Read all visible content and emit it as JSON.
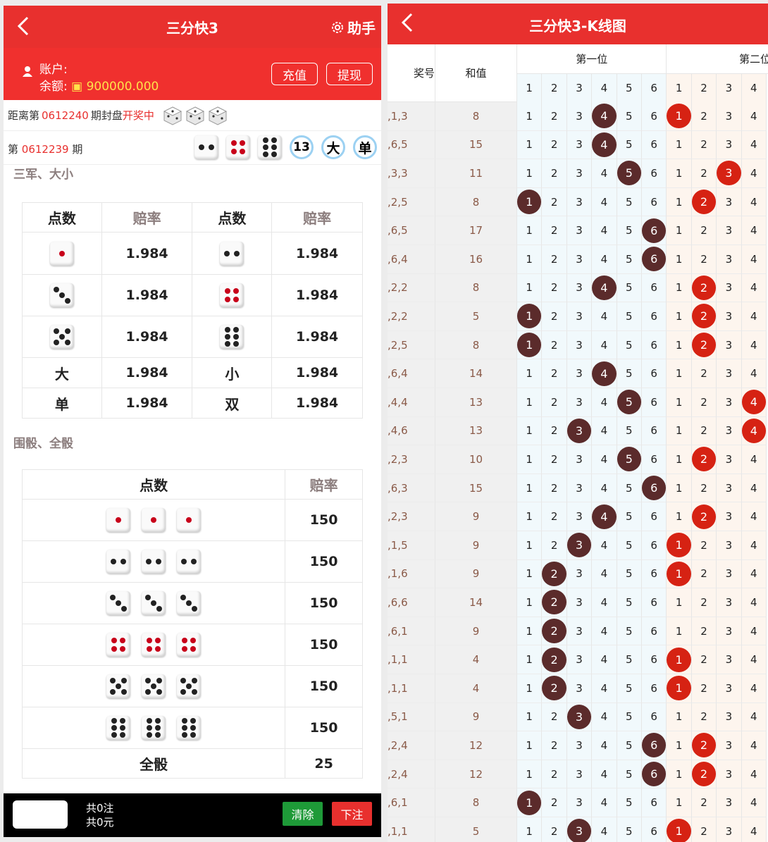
{
  "left": {
    "header": {
      "title": "三分快3",
      "helper": "助手"
    },
    "account": {
      "label_account": "账户:",
      "label_balance": "余额:",
      "balance": "900000.000",
      "recharge": "充值",
      "withdraw": "提现"
    },
    "next": {
      "prefix": "距离第",
      "issue": "0612240",
      "mid": "期封盘",
      "status": "开奖中"
    },
    "prev": {
      "prefix": "第",
      "issue": "0612239",
      "suffix": "期",
      "dice": [
        2,
        4,
        6
      ],
      "sum": "13",
      "size": "大",
      "parity": "单"
    },
    "section1": "三军、大小",
    "table1": {
      "headers": [
        "点数",
        "赔率",
        "点数",
        "赔率"
      ],
      "rows": [
        {
          "a": {
            "die": 1
          },
          "ao": "1.984",
          "b": {
            "die": 2
          },
          "bo": "1.984"
        },
        {
          "a": {
            "die": 3
          },
          "ao": "1.984",
          "b": {
            "die": 4
          },
          "bo": "1.984"
        },
        {
          "a": {
            "die": 5
          },
          "ao": "1.984",
          "b": {
            "die": 6
          },
          "bo": "1.984"
        },
        {
          "a": {
            "text": "大"
          },
          "ao": "1.984",
          "b": {
            "text": "小"
          },
          "bo": "1.984"
        },
        {
          "a": {
            "text": "单"
          },
          "ao": "1.984",
          "b": {
            "text": "双"
          },
          "bo": "1.984"
        }
      ]
    },
    "section2": "围骰、全骰",
    "table2": {
      "headers": [
        "点数",
        "赔率"
      ],
      "rows": [
        {
          "die": 1,
          "odds": "150"
        },
        {
          "die": 2,
          "odds": "150"
        },
        {
          "die": 3,
          "odds": "150"
        },
        {
          "die": 4,
          "odds": "150"
        },
        {
          "die": 5,
          "odds": "150"
        },
        {
          "die": 6,
          "odds": "150"
        },
        {
          "text": "全骰",
          "odds": "25"
        }
      ]
    },
    "bottom": {
      "count": "共0注",
      "amount": "共0元",
      "clear": "清除",
      "submit": "下注"
    },
    "colors": {
      "header": "#e8302e",
      "balance": "#ffe14a",
      "clear": "#1e9a38",
      "submit": "#e8302e"
    }
  },
  "right": {
    "header": {
      "title": "三分快3-K线图"
    },
    "columns": {
      "kj": "奖号",
      "hz": "和值",
      "pos1": "第一位",
      "pos2": "第二位",
      "ticks1": [
        "1",
        "2",
        "3",
        "4",
        "5",
        "6"
      ],
      "ticks2": [
        "1",
        "2",
        "3",
        "4"
      ]
    },
    "rows": [
      {
        "kj": ",1,3",
        "hz": "8",
        "p1": 4,
        "p2": 1
      },
      {
        "kj": ",6,5",
        "hz": "15",
        "p1": 4,
        "p2": 0
      },
      {
        "kj": ",3,3",
        "hz": "11",
        "p1": 5,
        "p2": 3
      },
      {
        "kj": ",2,5",
        "hz": "8",
        "p1": 1,
        "p2": 2
      },
      {
        "kj": ",6,5",
        "hz": "17",
        "p1": 6,
        "p2": 0
      },
      {
        "kj": ",6,4",
        "hz": "16",
        "p1": 6,
        "p2": 0
      },
      {
        "kj": ",2,2",
        "hz": "8",
        "p1": 4,
        "p2": 2
      },
      {
        "kj": ",2,2",
        "hz": "5",
        "p1": 1,
        "p2": 2
      },
      {
        "kj": ",2,5",
        "hz": "8",
        "p1": 1,
        "p2": 2
      },
      {
        "kj": ",6,4",
        "hz": "14",
        "p1": 4,
        "p2": 0
      },
      {
        "kj": ",4,4",
        "hz": "13",
        "p1": 5,
        "p2": 4
      },
      {
        "kj": ",4,6",
        "hz": "13",
        "p1": 3,
        "p2": 4
      },
      {
        "kj": ",2,3",
        "hz": "10",
        "p1": 5,
        "p2": 2
      },
      {
        "kj": ",6,3",
        "hz": "15",
        "p1": 6,
        "p2": 0
      },
      {
        "kj": ",2,3",
        "hz": "9",
        "p1": 4,
        "p2": 2
      },
      {
        "kj": ",1,5",
        "hz": "9",
        "p1": 3,
        "p2": 1
      },
      {
        "kj": ",1,6",
        "hz": "9",
        "p1": 2,
        "p2": 1
      },
      {
        "kj": ",6,6",
        "hz": "14",
        "p1": 2,
        "p2": 0
      },
      {
        "kj": ",6,1",
        "hz": "9",
        "p1": 2,
        "p2": 0
      },
      {
        "kj": ",1,1",
        "hz": "4",
        "p1": 2,
        "p2": 1
      },
      {
        "kj": ",1,1",
        "hz": "4",
        "p1": 2,
        "p2": 1
      },
      {
        "kj": ",5,1",
        "hz": "9",
        "p1": 3,
        "p2": 0
      },
      {
        "kj": ",2,4",
        "hz": "12",
        "p1": 6,
        "p2": 2
      },
      {
        "kj": ",2,4",
        "hz": "12",
        "p1": 6,
        "p2": 2
      },
      {
        "kj": ",6,1",
        "hz": "8",
        "p1": 1,
        "p2": 0
      },
      {
        "kj": ",1,1",
        "hz": "5",
        "p1": 3,
        "p2": 1
      }
    ]
  }
}
